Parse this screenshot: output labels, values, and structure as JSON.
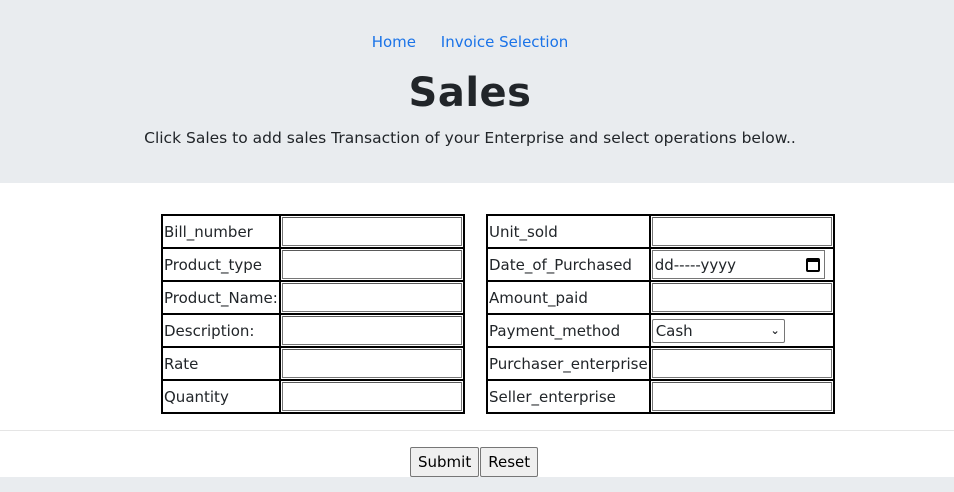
{
  "nav": {
    "home": "Home",
    "invoice": "Invoice Selection"
  },
  "header": {
    "title": "Sales",
    "subtitle": "Click Sales to add sales Transaction of your Enterprise and select operations below.."
  },
  "left_form": {
    "fields": [
      {
        "label": "Bill_number",
        "value": ""
      },
      {
        "label": "Product_type",
        "value": ""
      },
      {
        "label": "Product_Name:",
        "value": ""
      },
      {
        "label": "Description:",
        "value": ""
      },
      {
        "label": "Rate",
        "value": ""
      },
      {
        "label": "Quantity",
        "value": ""
      }
    ]
  },
  "right_form": {
    "unit_sold": {
      "label": "Unit_sold",
      "value": ""
    },
    "date": {
      "label": "Date_of_Purchased",
      "placeholder": "dd-----yyyy"
    },
    "amount": {
      "label": "Amount_paid",
      "value": ""
    },
    "payment": {
      "label": "Payment_method",
      "selected": "Cash"
    },
    "purchaser": {
      "label": "Purchaser_enterprise",
      "value": ""
    },
    "seller": {
      "label": "Seller_enterprise",
      "value": ""
    }
  },
  "buttons": {
    "submit": "Submit",
    "reset": "Reset"
  }
}
